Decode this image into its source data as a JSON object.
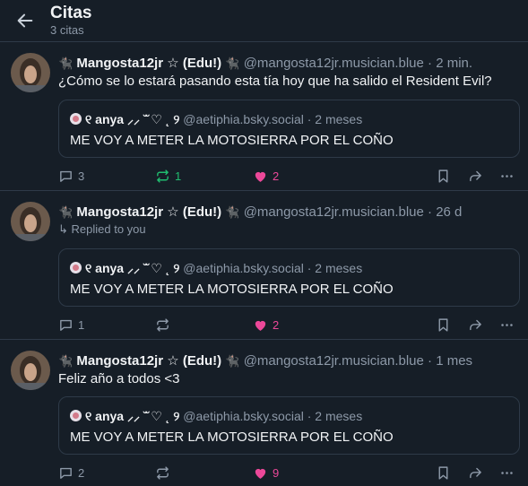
{
  "header": {
    "title": "Citas",
    "subtitle": "3 citas"
  },
  "colors": {
    "background": "#161e27",
    "repost_active": "#20bc6f",
    "like_active": "#ec4899",
    "muted": "#8d99a8"
  },
  "posts": [
    {
      "cat_left": "🐈‍⬛",
      "display_name": "Mangosta12jr ☆ (Edu!)",
      "cat_right": "🐈‍⬛",
      "handle": "@mangosta12jr.musician.blue",
      "time": "· 2 min.",
      "replied": "",
      "text": "¿Cómo se lo estará pasando esta tía hoy que ha salido el Resident Evil?",
      "quote": {
        "name": "୧ anya ⸝⸝ ˘̆ ♡ ˛ ୨",
        "handle": "@aetiphia.bsky.social",
        "time": "· 2 meses",
        "text": "ME VOY A METER LA MOTOSIERRA POR EL COÑO"
      },
      "replies": "3",
      "reposts": "1",
      "likes": "2",
      "reposted": true
    },
    {
      "cat_left": "🐈‍⬛",
      "display_name": "Mangosta12jr ☆ (Edu!)",
      "cat_right": "🐈‍⬛",
      "handle": "@mangosta12jr.musician.blue",
      "time": "· 26 d",
      "replied": "↳ Replied to you",
      "text": "",
      "quote": {
        "name": "୧ anya ⸝⸝ ˘̆ ♡ ˛ ୨",
        "handle": "@aetiphia.bsky.social",
        "time": "· 2 meses",
        "text": "ME VOY A METER LA MOTOSIERRA POR EL COÑO"
      },
      "replies": "1",
      "reposts": "",
      "likes": "2",
      "reposted": false
    },
    {
      "cat_left": "🐈‍⬛",
      "display_name": "Mangosta12jr ☆ (Edu!)",
      "cat_right": "🐈‍⬛",
      "handle": "@mangosta12jr.musician.blue",
      "time": "· 1 mes",
      "replied": "",
      "text": "Feliz año a todos <3",
      "quote": {
        "name": "୧ anya ⸝⸝ ˘̆ ♡ ˛ ୨",
        "handle": "@aetiphia.bsky.social",
        "time": "· 2 meses",
        "text": "ME VOY A METER LA MOTOSIERRA POR EL COÑO"
      },
      "replies": "2",
      "reposts": "",
      "likes": "9",
      "reposted": false
    }
  ]
}
